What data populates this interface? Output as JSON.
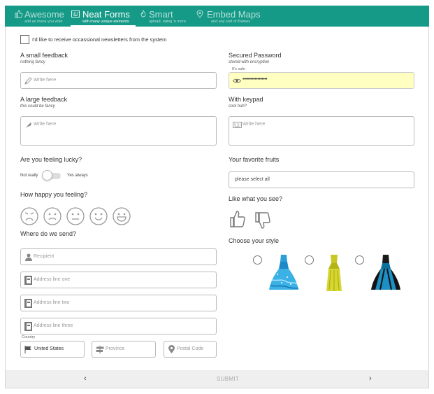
{
  "tabs": [
    {
      "title": "Awesome",
      "subtitle": "add as many you wish",
      "icon": "thumbs-up-icon"
    },
    {
      "title": "Neat Forms",
      "subtitle": "with many unique elements",
      "icon": "keyboard-icon"
    },
    {
      "title": "Smart",
      "subtitle": "upload, rating 'n more",
      "icon": "flame-icon"
    },
    {
      "title": "Embed Maps",
      "subtitle": "and any sort of iframes",
      "icon": "map-pin-icon"
    }
  ],
  "newsletter": {
    "label": "I'd like to receive occassional newsletters from the system"
  },
  "small_feedback": {
    "label": "A small feedback",
    "sub": "nothing fancy",
    "placeholder": "Write here"
  },
  "password": {
    "label": "Secured Password",
    "sub": "stored with encryption",
    "hint": "It's safe",
    "value": "••••••••••••••••••"
  },
  "large_feedback": {
    "label": "A large feedback",
    "sub": "this could be fancy",
    "placeholder": "Write here"
  },
  "keypad": {
    "label": "With keypad",
    "sub": "cool huh?",
    "placeholder": "Write here"
  },
  "lucky": {
    "label": "Are you feeling lucky?",
    "off": "Not really",
    "on": "Yes always",
    "value": false
  },
  "fruits": {
    "label": "Your favorite fruits",
    "placeholder": "please select all"
  },
  "happy": {
    "label": "How happy you feeling?"
  },
  "like": {
    "label": "Like what you see?"
  },
  "address": {
    "label": "Where do we send?",
    "recipient": "Recipient",
    "line1": "Address line one",
    "line2": "Address line two",
    "line3": "Address line three",
    "country_label": "Country",
    "country": "United States",
    "province": "Province",
    "postal": "Postal Code"
  },
  "style": {
    "label": "Choose your style"
  },
  "footer": {
    "prev": "‹",
    "submit": "SUBMIT",
    "next": "›"
  },
  "colors": {
    "header": "#159a87",
    "password_bg": "#ffffc2"
  }
}
